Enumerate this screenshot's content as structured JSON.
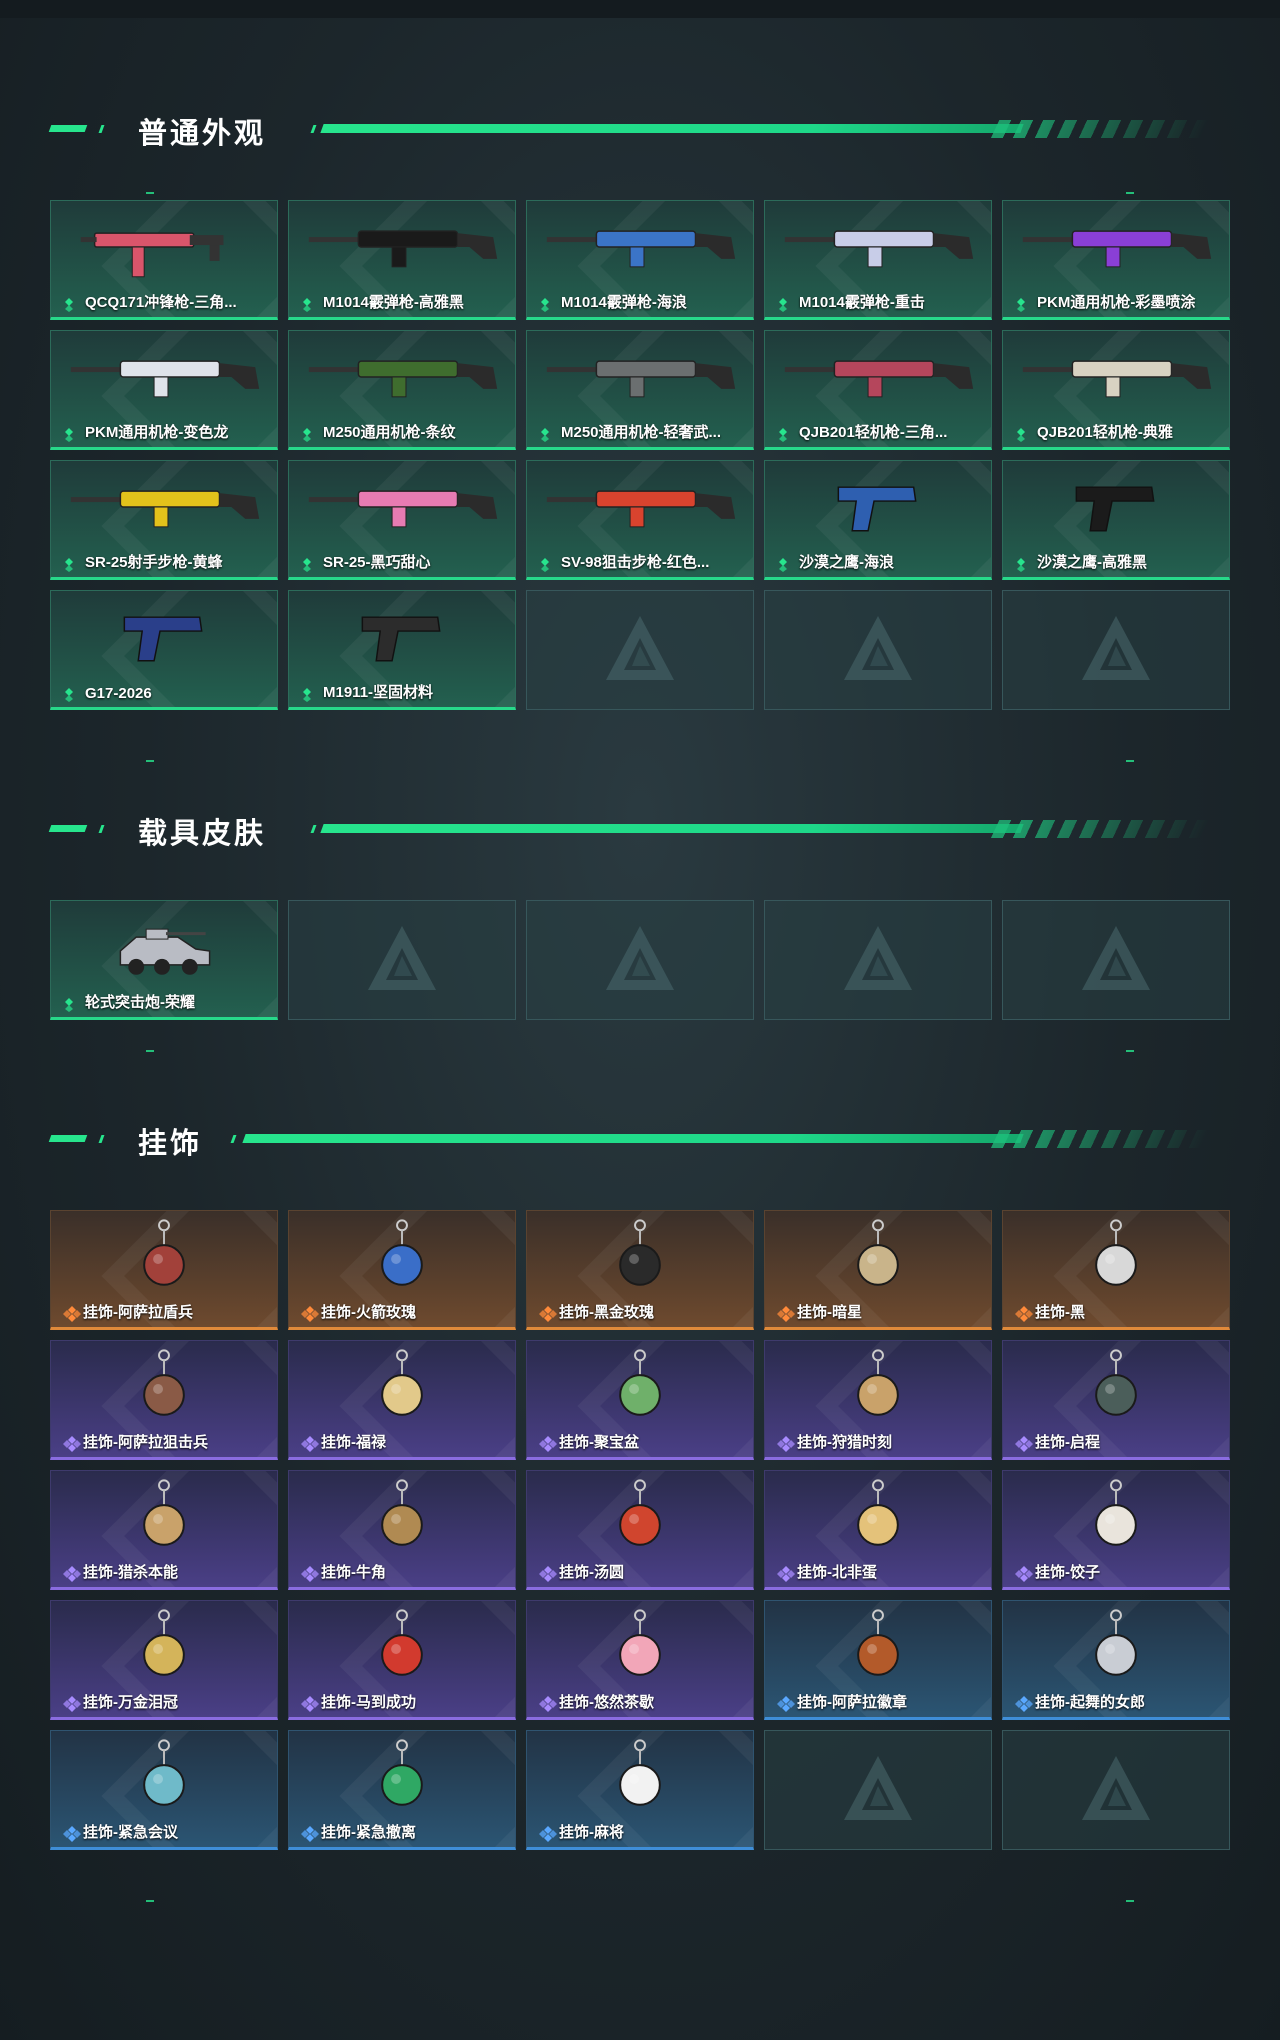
{
  "colors": {
    "accent": "#27e58d",
    "common_green": "#27d98a",
    "epic_purple": "#8a6ce0",
    "legendary_orange": "#e08a3a",
    "rare_blue": "#3f8ed8"
  },
  "sections": {
    "weapons": {
      "title": "普通外观",
      "items": [
        {
          "label": "QCQ171冲锋枪-三角...",
          "icon": "smg-icon",
          "color": "#d9556b"
        },
        {
          "label": "M1014霰弹枪-高雅黑",
          "icon": "shotgun-icon",
          "color": "#1a1a1a"
        },
        {
          "label": "M1014霰弹枪-海浪",
          "icon": "shotgun-icon",
          "color": "#3b74c7"
        },
        {
          "label": "M1014霰弹枪-重击",
          "icon": "shotgun-icon",
          "color": "#c8cde8"
        },
        {
          "label": "PKM通用机枪-彩墨喷涂",
          "icon": "machine-gun-icon",
          "color": "#8a3fd6"
        },
        {
          "label": "PKM通用机枪-变色龙",
          "icon": "machine-gun-icon",
          "color": "#dfe3ea"
        },
        {
          "label": "M250通用机枪-条纹",
          "icon": "machine-gun-icon",
          "color": "#3f6d2e"
        },
        {
          "label": "M250通用机枪-轻奢武...",
          "icon": "machine-gun-icon",
          "color": "#6b6f70"
        },
        {
          "label": "QJB201轻机枪-三角...",
          "icon": "light-machine-gun-icon",
          "color": "#b5465c"
        },
        {
          "label": "QJB201轻机枪-典雅",
          "icon": "light-machine-gun-icon",
          "color": "#d8d2c2"
        },
        {
          "label": "SR-25射手步枪-黄蜂",
          "icon": "rifle-icon",
          "color": "#e3c21b"
        },
        {
          "label": "SR-25-黑巧甜心",
          "icon": "rifle-icon",
          "color": "#e77bb2"
        },
        {
          "label": "SV-98狙击步枪-红色...",
          "icon": "sniper-rifle-icon",
          "color": "#d9432e"
        },
        {
          "label": "沙漠之鹰-海浪",
          "icon": "pistol-icon",
          "color": "#2e5fb0"
        },
        {
          "label": "沙漠之鹰-高雅黑",
          "icon": "pistol-icon",
          "color": "#1b1b1b"
        },
        {
          "label": "G17-2026",
          "icon": "pistol-icon",
          "color": "#2a3f8a"
        },
        {
          "label": "M1911-坚固材料",
          "icon": "pistol-icon",
          "color": "#2c2c2c"
        }
      ]
    },
    "vehicles": {
      "title": "载具皮肤",
      "items": [
        {
          "label": "轮式突击炮-荣耀",
          "icon": "armored-vehicle-icon",
          "color": "#b9bcc4"
        }
      ]
    },
    "charms": {
      "title": "挂饰",
      "items": [
        {
          "label": "挂饰-阿萨拉盾兵",
          "rarity": "orange",
          "color": "#a2413a"
        },
        {
          "label": "挂饰-火箭玫瑰",
          "rarity": "orange",
          "color": "#3a6ec8"
        },
        {
          "label": "挂饰-黑金玫瑰",
          "rarity": "orange",
          "color": "#2a2a2a"
        },
        {
          "label": "挂饰-暗星",
          "rarity": "orange",
          "color": "#c9b48a"
        },
        {
          "label": "挂饰-黑",
          "rarity": "orange",
          "color": "#d8d8d8"
        },
        {
          "label": "挂饰-阿萨拉狙击兵",
          "rarity": "purple",
          "color": "#8a5a46"
        },
        {
          "label": "挂饰-福禄",
          "rarity": "purple",
          "color": "#e2c98a"
        },
        {
          "label": "挂饰-聚宝盆",
          "rarity": "purple",
          "color": "#6fb06a"
        },
        {
          "label": "挂饰-狩猎时刻",
          "rarity": "purple",
          "color": "#c9a26a"
        },
        {
          "label": "挂饰-启程",
          "rarity": "purple",
          "color": "#4b5e5a"
        },
        {
          "label": "挂饰-猎杀本能",
          "rarity": "purple",
          "color": "#c9a26a"
        },
        {
          "label": "挂饰-牛角",
          "rarity": "purple",
          "color": "#b08a52"
        },
        {
          "label": "挂饰-汤圆",
          "rarity": "purple",
          "color": "#d0452e"
        },
        {
          "label": "挂饰-北非蛋",
          "rarity": "purple",
          "color": "#e4c27a"
        },
        {
          "label": "挂饰-饺子",
          "rarity": "purple",
          "color": "#e9e4dc"
        },
        {
          "label": "挂饰-万金泪冠",
          "rarity": "purple",
          "color": "#d4b45a"
        },
        {
          "label": "挂饰-马到成功",
          "rarity": "purple",
          "color": "#d23a2e"
        },
        {
          "label": "挂饰-悠然茶歇",
          "rarity": "purple",
          "color": "#f2a6b8"
        },
        {
          "label": "挂饰-阿萨拉徽章",
          "rarity": "blue",
          "color": "#b35a2a"
        },
        {
          "label": "挂饰-起舞的女郎",
          "rarity": "blue",
          "color": "#c9cdd4"
        },
        {
          "label": "挂饰-紧急会议",
          "rarity": "blue",
          "color": "#6fbac9"
        },
        {
          "label": "挂饰-紧急撤离",
          "rarity": "blue",
          "color": "#2fa864"
        },
        {
          "label": "挂饰-麻将",
          "rarity": "blue",
          "color": "#f2f2f2"
        }
      ]
    }
  }
}
